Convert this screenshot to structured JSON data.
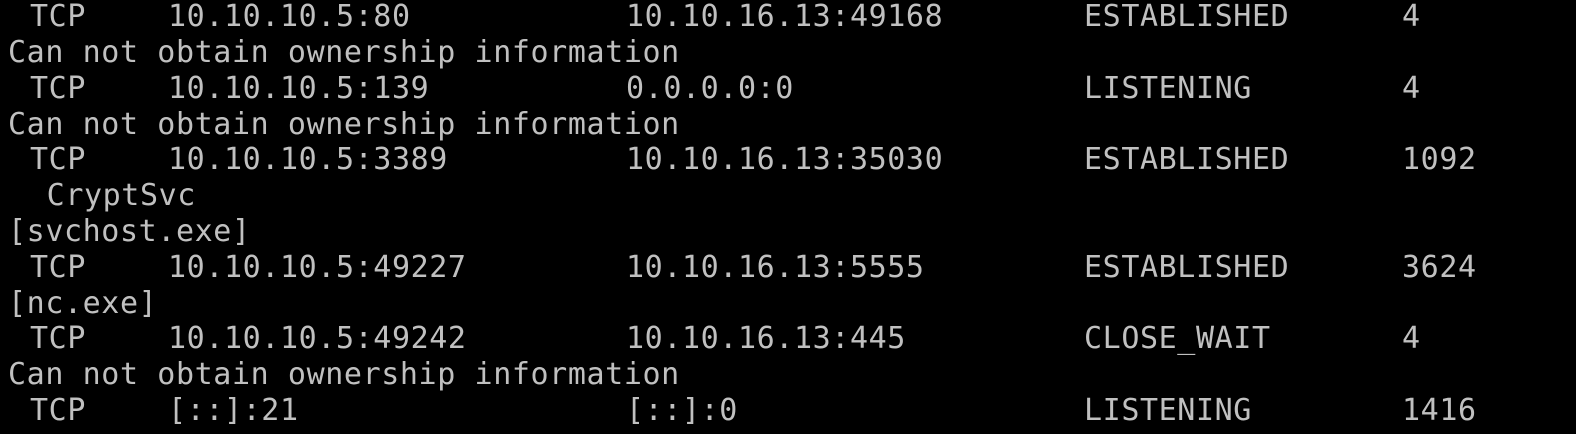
{
  "terminal": {
    "rows": [
      {
        "kind": "conn",
        "proto": "TCP",
        "local": "10.10.10.5:80",
        "foreign": "10.10.16.13:49168",
        "state": "ESTABLISHED",
        "pid": "4"
      },
      {
        "kind": "text",
        "text": "Can not obtain ownership information"
      },
      {
        "kind": "conn",
        "proto": "TCP",
        "local": "10.10.10.5:139",
        "foreign": "0.0.0.0:0",
        "state": "LISTENING",
        "pid": "4"
      },
      {
        "kind": "text",
        "text": "Can not obtain ownership information"
      },
      {
        "kind": "conn",
        "proto": "TCP",
        "local": "10.10.10.5:3389",
        "foreign": "10.10.16.13:35030",
        "state": "ESTABLISHED",
        "pid": "1092"
      },
      {
        "kind": "text",
        "text": " CryptSvc"
      },
      {
        "kind": "text",
        "text": "[svchost.exe]"
      },
      {
        "kind": "conn",
        "proto": "TCP",
        "local": "10.10.10.5:49227",
        "foreign": "10.10.16.13:5555",
        "state": "ESTABLISHED",
        "pid": "3624"
      },
      {
        "kind": "text",
        "text": "[nc.exe]"
      },
      {
        "kind": "conn",
        "proto": "TCP",
        "local": "10.10.10.5:49242",
        "foreign": "10.10.16.13:445",
        "state": "CLOSE_WAIT",
        "pid": "4"
      },
      {
        "kind": "text",
        "text": "Can not obtain ownership information"
      },
      {
        "kind": "conn",
        "proto": "TCP",
        "local": "[::]:21",
        "foreign": "[::]:0",
        "state": "LISTENING",
        "pid": "1416"
      }
    ]
  }
}
